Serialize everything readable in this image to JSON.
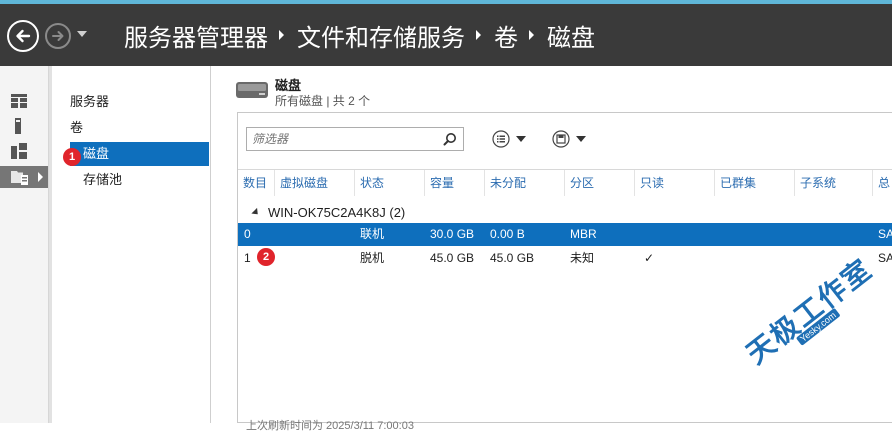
{
  "titlebar": {
    "breadcrumb": [
      "服务器管理器",
      "文件和存储服务",
      "卷",
      "磁盘"
    ]
  },
  "iconbar": {
    "items": [
      {
        "icon": "dashboard-grid-icon"
      },
      {
        "icon": "local-server-icon"
      },
      {
        "icon": "all-servers-icon"
      },
      {
        "icon": "file-storage-icon",
        "active": true
      }
    ]
  },
  "navpane": {
    "items": [
      {
        "label": "服务器"
      },
      {
        "label": "卷"
      },
      {
        "label": "磁盘",
        "active": true
      },
      {
        "label": "存储池"
      }
    ]
  },
  "annotations": {
    "badge1": "1",
    "badge2": "2"
  },
  "header": {
    "title": "磁盘",
    "subtitle": "所有磁盘 | 共 2 个"
  },
  "toolbar": {
    "filter_placeholder": "筛选器"
  },
  "table": {
    "columns": [
      "数目",
      "虚拟磁盘",
      "状态",
      "容量",
      "未分配",
      "分区",
      "只读",
      "已群集",
      "子系统",
      "总"
    ],
    "group": "WIN-OK75C2A4K8J (2)",
    "rows": [
      {
        "number": "0",
        "virtual": "",
        "status": "联机",
        "capacity": "30.0 GB",
        "unallocated": "0.00 B",
        "partition": "MBR",
        "readonly": "",
        "clustered": "",
        "subsystem": "",
        "bus": "SA",
        "selected": true
      },
      {
        "number": "1",
        "virtual": "",
        "status": "脱机",
        "capacity": "45.0 GB",
        "unallocated": "45.0 GB",
        "partition": "未知",
        "readonly": "✓",
        "clustered": "",
        "subsystem": "",
        "bus": "SA",
        "selected": false
      }
    ]
  },
  "footer": {
    "text": "上次刷新时间为 2025/3/11 7:00:03"
  },
  "watermark": {
    "text": "天极工作室",
    "small": "Yesky.com"
  },
  "colors": {
    "accent": "#0e6fbd",
    "titlebar": "#3a3a3a",
    "badge": "#e0242b"
  }
}
